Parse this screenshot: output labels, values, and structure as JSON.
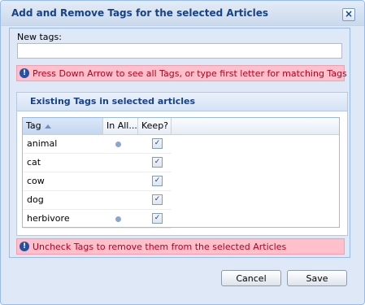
{
  "dialog": {
    "title": "Add and Remove Tags for the selected Articles",
    "close_icon": "close-icon"
  },
  "new_tags": {
    "label": "New tags:",
    "value": "",
    "placeholder": ""
  },
  "hint_top": "Press Down Arrow to see all Tags, or type first letter for matching Tags",
  "existing": {
    "legend": "Existing Tags in selected articles",
    "columns": {
      "tag": "Tag",
      "in_all": "In All...",
      "keep": "Keep?"
    },
    "sort": "ascending",
    "rows": [
      {
        "tag": "animal",
        "in_all": true,
        "keep": true
      },
      {
        "tag": "cat",
        "in_all": false,
        "keep": true
      },
      {
        "tag": "cow",
        "in_all": false,
        "keep": true
      },
      {
        "tag": "dog",
        "in_all": false,
        "keep": true
      },
      {
        "tag": "herbivore",
        "in_all": true,
        "keep": true
      }
    ]
  },
  "hint_bottom": "Uncheck Tags to remove them from the selected Articles",
  "buttons": {
    "cancel": "Cancel",
    "save": "Save"
  },
  "colors": {
    "title": "#15428b",
    "hint_bg": "#ffc0cb",
    "hint_text": "#b4001e",
    "panel_bg": "#dfe8f6"
  }
}
